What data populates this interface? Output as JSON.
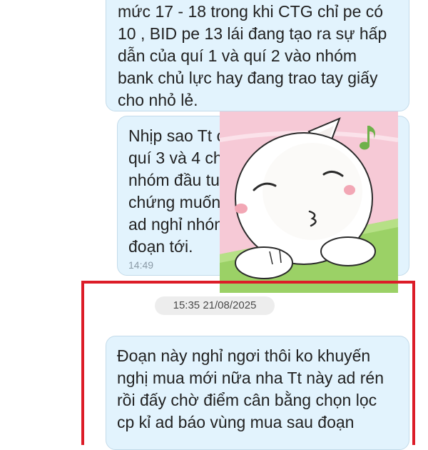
{
  "messages": [
    {
      "text": "mức 17 - 18 trong khi CTG chỉ pe có\n10 , BID pe 13 lái đang tạo ra sự hấp\ndẫn của quí 1 và quí 2 vào nhóm\nbank chủ lực hay đang trao tay giấy\ncho nhỏ lẻ."
    },
    {
      "text": "Nhịp sao Tt c\nquí 3 và 4 ch\nnhóm đầu tu\nchứng muốn\nad nghỉ nhón\nđoạn tới.",
      "time": "14:49"
    },
    {
      "text": "Đoạn này nghỉ ngơi thôi ko khuyến\nnghị mua mới nữa nha Tt này ad rén\nrồi đấy chờ điểm cân bằng chọn lọc\ncp kỉ ad báo vùng mua sau đoạn"
    }
  ],
  "date_separator": "15:35 21/08/2025",
  "sticker": {
    "icon": "cat-sticker-icon"
  },
  "colors": {
    "bubble_bg": "#e2f3fd",
    "bubble_border": "#c3dbea",
    "highlight_frame": "#dc1c28",
    "sticker_bg": "#f6c9d6",
    "sticker_table": "#9bd166"
  }
}
